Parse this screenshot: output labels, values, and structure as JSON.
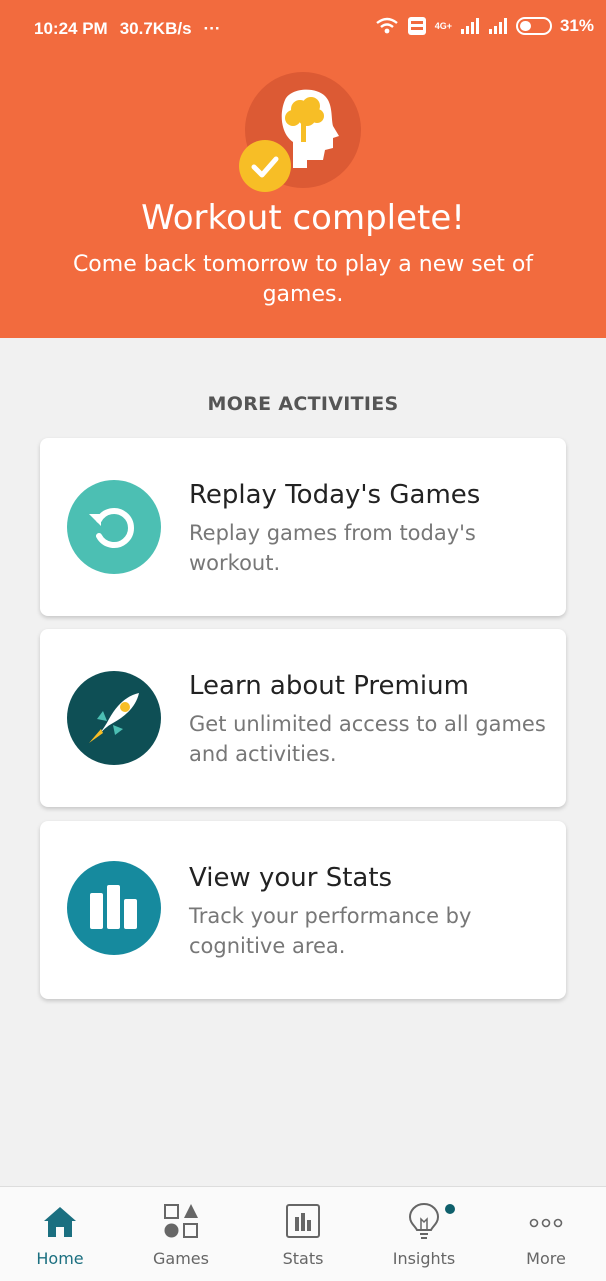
{
  "status_bar": {
    "time": "10:24 PM",
    "speed": "30.7KB/s",
    "dots": "···",
    "network": "4G+",
    "battery": "31%"
  },
  "header": {
    "title": "Workout complete!",
    "subtitle": "Come back tomorrow to play a new set of games.",
    "colors": {
      "background": "#f26b3e",
      "logo_circle": "#dc5a34",
      "badge": "#f7be26"
    }
  },
  "section": {
    "label": "MORE ACTIVITIES"
  },
  "cards": [
    {
      "icon": "replay-icon",
      "title": "Replay Today's Games",
      "description": "Replay games from today's workout.",
      "color": "#4cbfb3"
    },
    {
      "icon": "rocket-icon",
      "title": "Learn about Premium",
      "description": "Get unlimited access to all games and activities.",
      "color": "#0e4f55"
    },
    {
      "icon": "bar-chart-icon",
      "title": "View your Stats",
      "description": "Track your performance by cognitive area.",
      "color": "#168a9e"
    }
  ],
  "bottom_nav": [
    {
      "label": "Home",
      "icon": "home-icon",
      "active": true
    },
    {
      "label": "Games",
      "icon": "games-icon",
      "active": false
    },
    {
      "label": "Stats",
      "icon": "stats-icon",
      "active": false
    },
    {
      "label": "Insights",
      "icon": "lightbulb-icon",
      "active": false
    },
    {
      "label": "More",
      "icon": "more-icon",
      "active": false
    }
  ]
}
